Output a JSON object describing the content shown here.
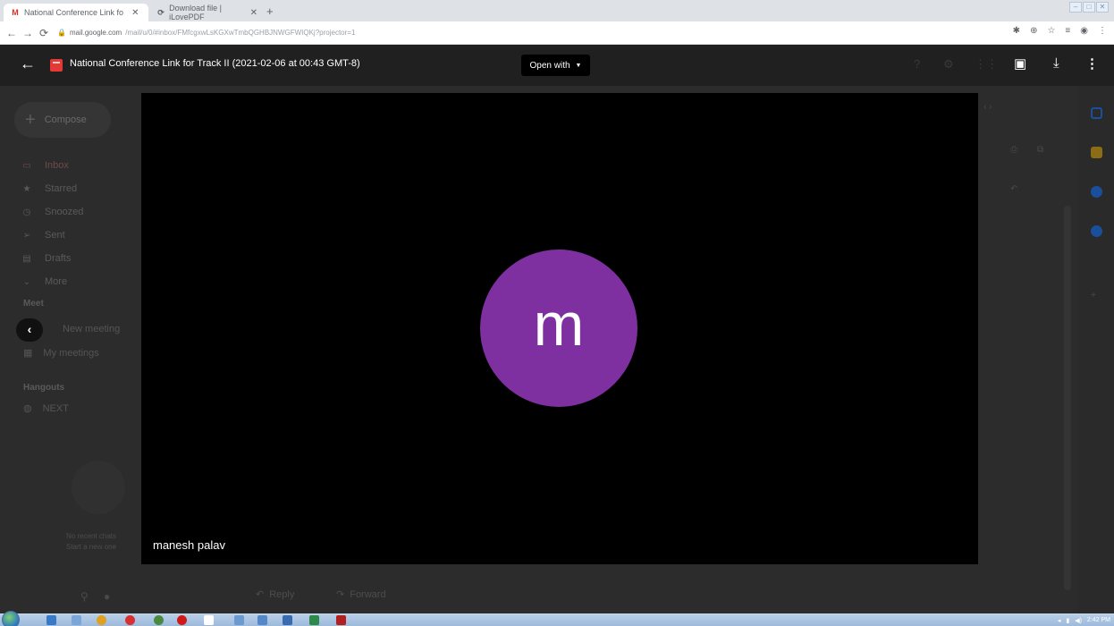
{
  "browser": {
    "tabs": [
      {
        "title": "National Conference Link fo",
        "favicon": "M",
        "active": true
      },
      {
        "title": "Download file | iLovePDF",
        "favicon": "⟳",
        "active": false
      }
    ],
    "url_host": "mail.google.com",
    "url_path": "/mail/u/0/#inbox/FMfcgxwLsKGXwTmbQGHBJNWGFWIQKj?projector=1"
  },
  "viewer": {
    "title": "National Conference Link for Track II (2021-02-06 at 00:43 GMT-8)",
    "open_with_label": "Open with"
  },
  "video": {
    "avatar_letter": "m",
    "avatar_color": "#7e2fa0",
    "participant_name": "manesh palav"
  },
  "gmail": {
    "compose_label": "Compose",
    "nav": [
      "Inbox",
      "Starred",
      "Snoozed",
      "Sent",
      "Drafts",
      "More"
    ],
    "meet_title": "Meet",
    "meet_items": [
      "New meeting",
      "My meetings"
    ],
    "hangouts_title": "Hangouts",
    "hangouts_user": "NEXT",
    "side_note_1": "No recent chats",
    "side_note_2": "Start a new one",
    "reply_label": "Reply",
    "forward_label": "Forward"
  },
  "taskbar": {
    "time": "2:42 PM"
  }
}
